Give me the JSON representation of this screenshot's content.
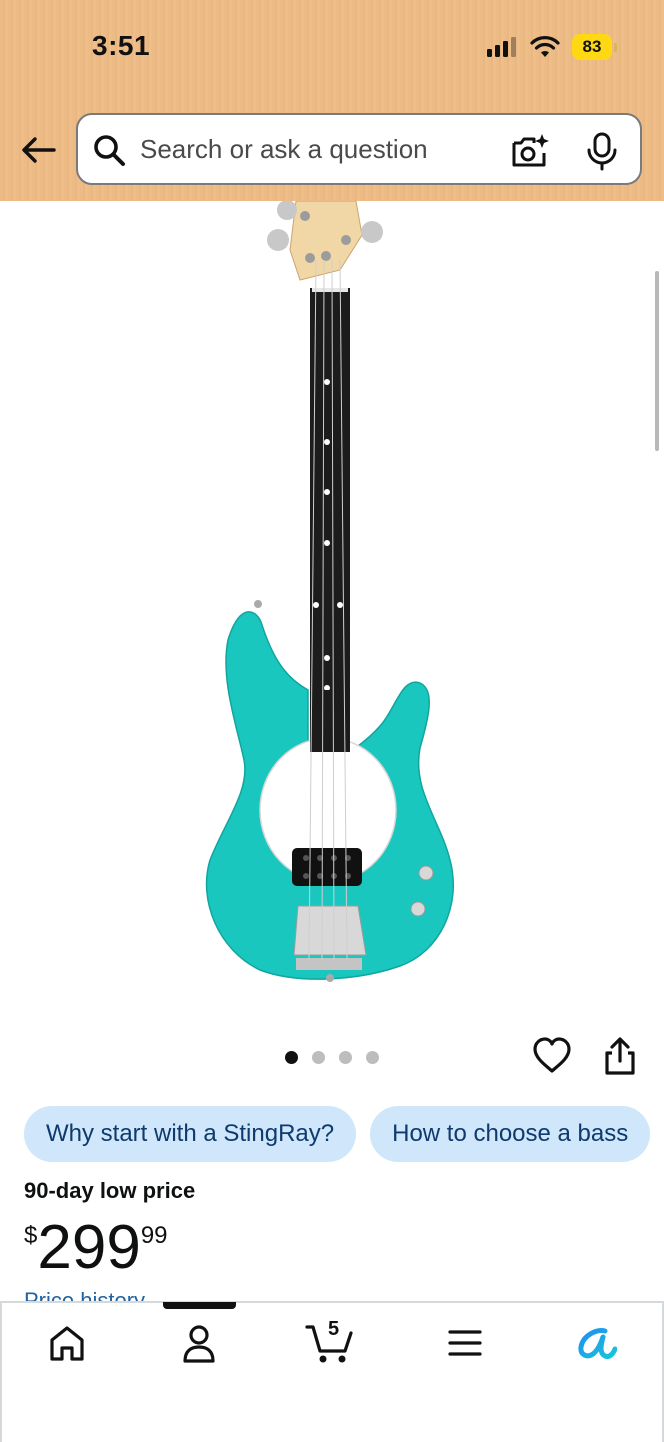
{
  "status_bar": {
    "time": "3:51",
    "battery": "83",
    "icons": [
      "signal-icon",
      "wifi-icon",
      "battery-icon"
    ]
  },
  "header": {
    "back_icon": "arrow-left-icon",
    "search_placeholder": "Search or ask a question",
    "camera_icon": "camera-sparkle-icon",
    "mic_icon": "microphone-icon"
  },
  "product_image": {
    "subject": "turquoise electric bass guitar",
    "carousel_pages": 4,
    "active_page": 1
  },
  "actions": {
    "wishlist_icon": "heart-icon",
    "share_icon": "share-icon"
  },
  "chips": [
    {
      "label": "Why start with a StingRay?"
    },
    {
      "label": "How to choose a bass"
    }
  ],
  "price": {
    "label": "90-day low price",
    "currency": "$",
    "whole": "299",
    "fraction": "99",
    "history_link": "Price history"
  },
  "bottom_nav": {
    "items": [
      {
        "name": "home",
        "icon": "home-icon"
      },
      {
        "name": "account",
        "icon": "person-icon",
        "active": true
      },
      {
        "name": "cart",
        "icon": "cart-icon",
        "count": "5"
      },
      {
        "name": "menu",
        "icon": "menu-icon"
      },
      {
        "name": "rufus",
        "icon": "rufus-icon"
      }
    ]
  },
  "colors": {
    "header_bg": "#edbb85",
    "chip_bg": "#cfe6fb",
    "chip_text": "#0e3a6e",
    "battery": "#ffd814",
    "guitar_body": "#19c7bf",
    "link": "#2162a1"
  }
}
